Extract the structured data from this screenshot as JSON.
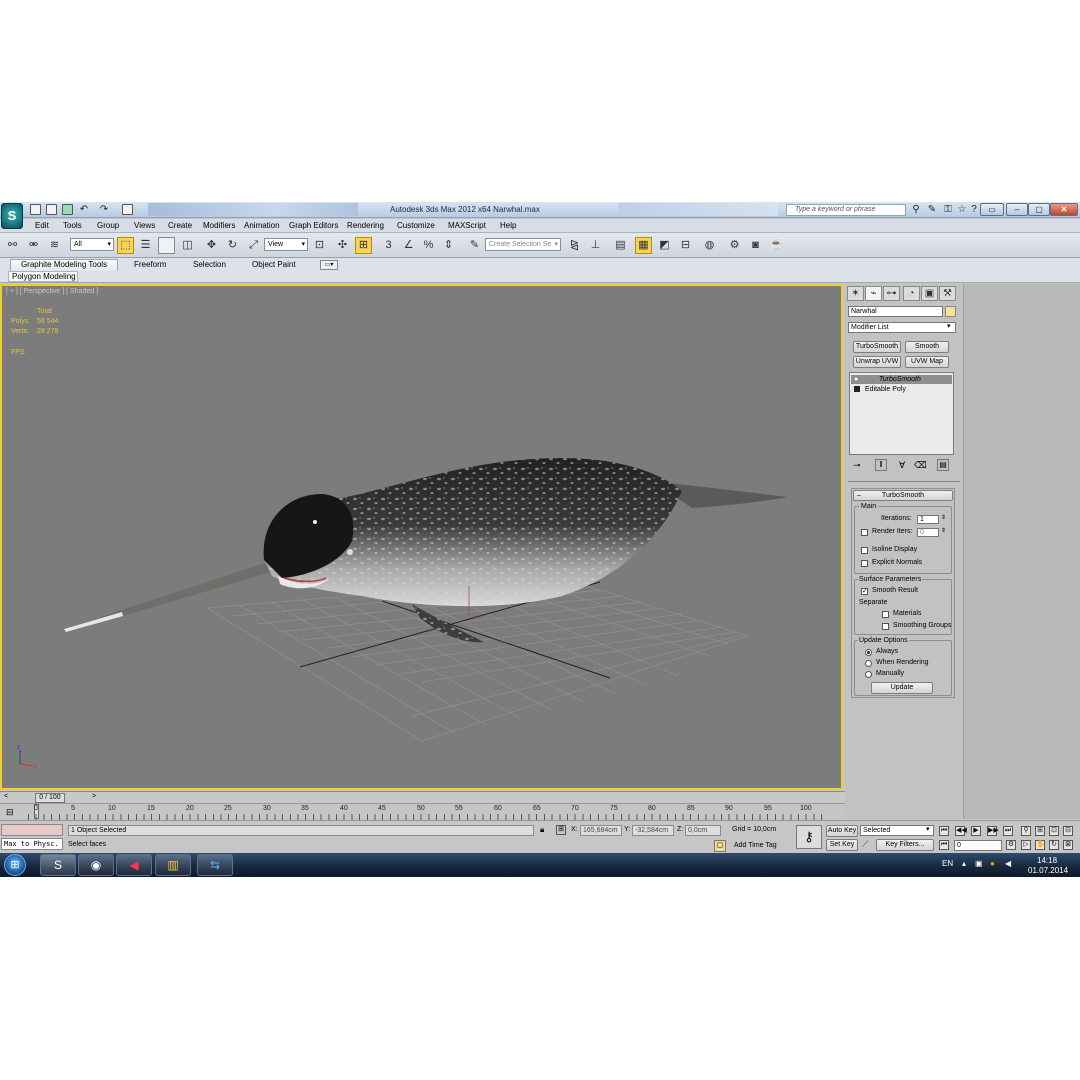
{
  "titlebar": {
    "title": "Autodesk 3ds Max  2012 x64      Narwhal.max",
    "search_placeholder": "Type a keyword or phrase",
    "app_logo": "3ds-max-logo"
  },
  "menu": [
    "Edit",
    "Tools",
    "Group",
    "Views",
    "Create",
    "Modifiers",
    "Animation",
    "Graph Editors",
    "Rendering",
    "Customize",
    "MAXScript",
    "Help"
  ],
  "toolbar": {
    "selection_filter": "All",
    "ref_coord": "View",
    "named_selection": "Create Selection Se"
  },
  "ribbon": {
    "tabs": [
      "Graphite Modeling Tools",
      "Freeform",
      "Selection",
      "Object Paint"
    ],
    "sub_tab": "Polygon Modeling"
  },
  "viewport": {
    "label": "[ + ] [ Perspective ] [ Shaded ]",
    "stats": {
      "total_label": "Total",
      "polys_label": "Polys:",
      "polys_value": "56 544",
      "verts_label": "Verts:",
      "verts_value": "28 278",
      "fps_label": "FPS"
    },
    "border_color": "#f2cf2c"
  },
  "command_panel": {
    "object_name": "Narwhal",
    "modifier_list": "Modifier List",
    "modifier_buttons": [
      "TurboSmooth",
      "Smooth",
      "Unwrap UVW",
      "UVW Map"
    ],
    "stack": [
      "TurboSmooth",
      "Editable Poly"
    ],
    "turbosmooth": {
      "title": "TurboSmooth",
      "main_label": "Main",
      "iterations_label": "Iterations:",
      "iterations_value": "1",
      "render_iters_label": "Render Iters:",
      "render_iters_value": "0",
      "isoline_display": "Isoline Display",
      "explicit_normals": "Explicit Normals",
      "surface_params_label": "Surface Parameters",
      "smooth_result": "Smooth Result",
      "separate_label": "Separate",
      "materials": "Materials",
      "smoothing_groups": "Smoothing Groups",
      "update_options_label": "Update Options",
      "always": "Always",
      "when_rendering": "When Rendering",
      "manually": "Manually",
      "update_button": "Update"
    }
  },
  "timeline": {
    "frame": "0 / 100",
    "ticks": [
      "0",
      "5",
      "10",
      "15",
      "20",
      "25",
      "30",
      "35",
      "40",
      "45",
      "50",
      "55",
      "60",
      "65",
      "70",
      "75",
      "80",
      "85",
      "90",
      "95",
      "100"
    ]
  },
  "status": {
    "maxscript": "Max to Physc.",
    "selection": "1 Object Selected",
    "prompt": "Select faces",
    "x_label": "X:",
    "x_value": "165,684cm",
    "y_label": "Y:",
    "y_value": "-32,584cm",
    "z_label": "Z:",
    "z_value": "0,0cm",
    "grid": "Grid = 10,0cm",
    "add_time_tag": "Add Time Tag",
    "auto_key": "Auto Key",
    "set_key": "Set Key",
    "selected_dropdown": "Selected",
    "key_filters": "Key Filters...",
    "frame_field": "0"
  },
  "taskbar": {
    "language": "EN",
    "time": "14:18",
    "date": "01.07.2014"
  }
}
